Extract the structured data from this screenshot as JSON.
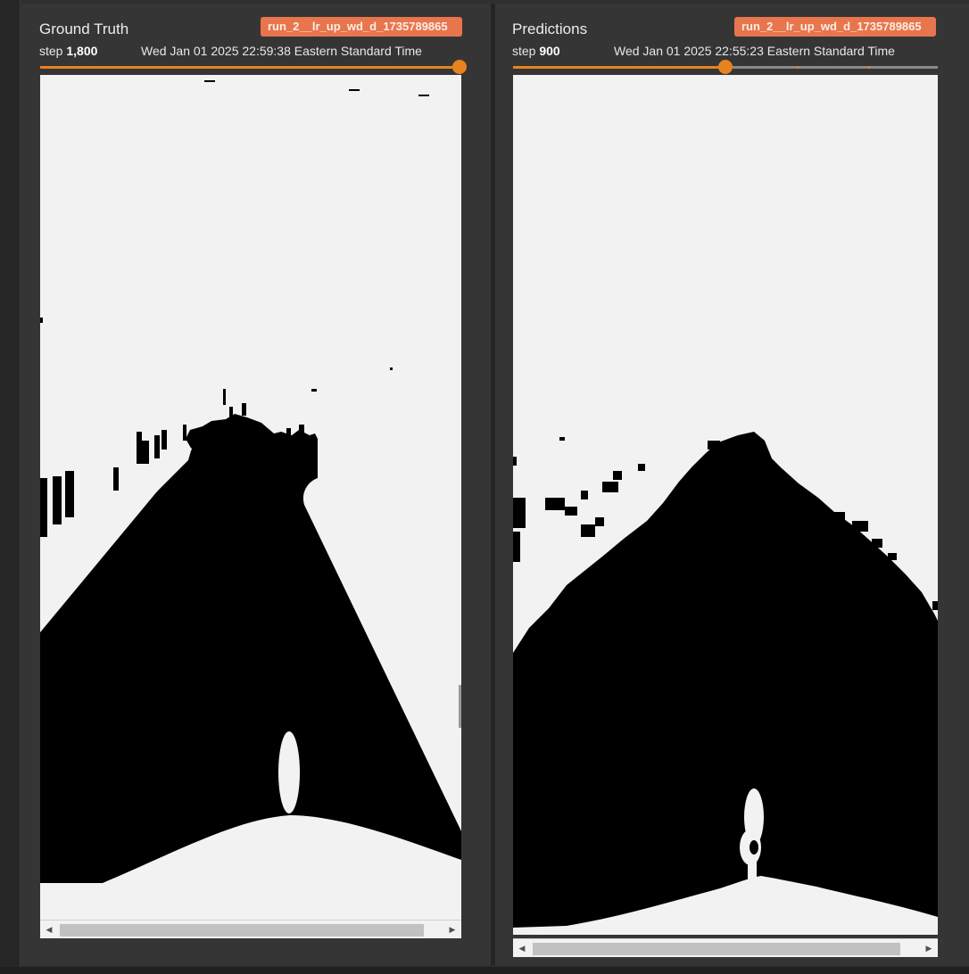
{
  "panels": {
    "ground_truth": {
      "title": "Ground Truth",
      "run_label": "run_2__lr_up_wd_d_1735789865",
      "step_prefix": "step",
      "step_value": "1,800",
      "timestamp": "Wed Jan 01 2025 22:59:38 Eastern Standard Time",
      "slider_progress": 1.0
    },
    "predictions": {
      "title": "Predictions",
      "run_label": "run_2__lr_up_wd_d_1735789865",
      "step_prefix": "step",
      "step_value": "900",
      "timestamp": "Wed Jan 01 2025 22:55:23 Eastern Standard Time",
      "slider_progress": 0.5
    }
  },
  "colors": {
    "accent": "#e8821e",
    "badge": "#e8754c",
    "panel_bg": "#353535",
    "mask_white": "#f2f2f2",
    "mask_black": "#000000"
  },
  "icons": {
    "scroll_left": "◀",
    "scroll_right": "▶"
  }
}
